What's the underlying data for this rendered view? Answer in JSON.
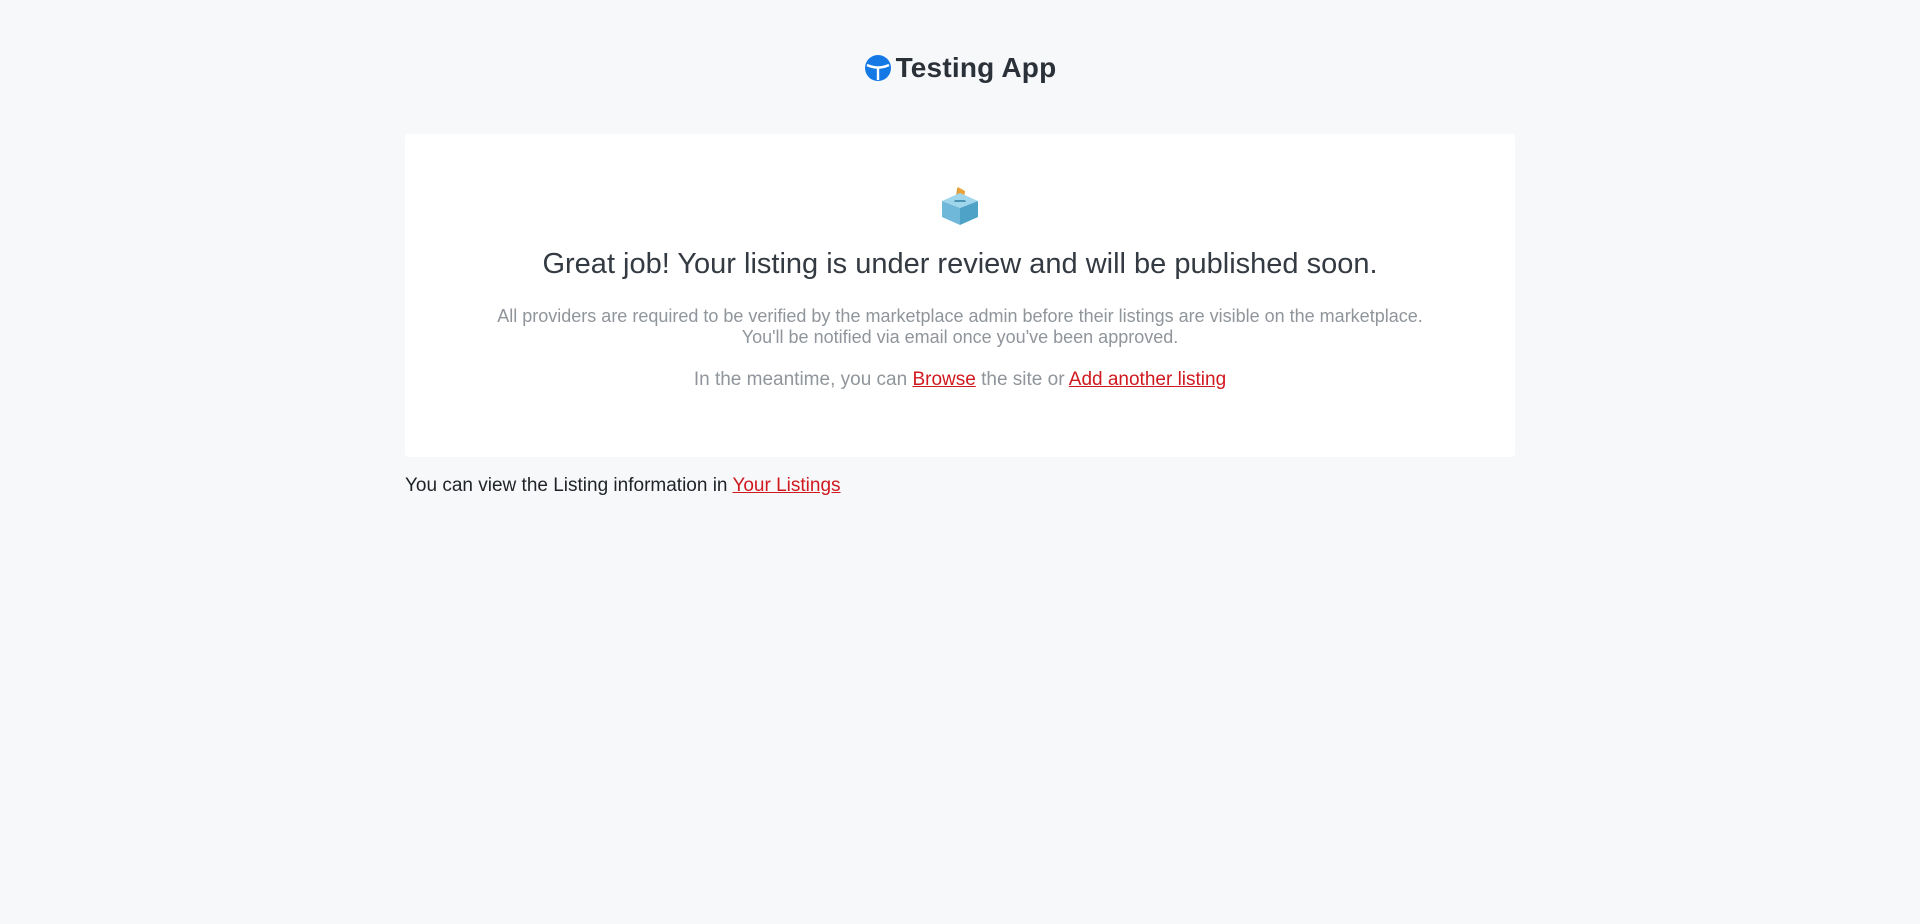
{
  "header": {
    "app_name": "Testing App",
    "logo_icon": "brand-logo-icon",
    "logo_color": "#1479e4"
  },
  "card": {
    "icon": "ballot-box-icon",
    "title": "Great job! Your listing is under review and will be published soon.",
    "body_line_1": "All providers are required to be verified by the marketplace admin before their listings are visible on the marketplace.",
    "body_line_2": "You'll be notified via email once you've been approved.",
    "cta_prefix": "In the meantime, you can",
    "browse_link": "Browse",
    "cta_middle": "the site or",
    "add_listing_link": "Add another listing"
  },
  "footer": {
    "note_prefix": "You can view the Listing information in",
    "your_listings_link": "Your Listings"
  },
  "colors": {
    "background": "#f7f8fa",
    "card_background": "#ffffff",
    "link": "#d0191f",
    "muted_text": "#8f959b"
  }
}
